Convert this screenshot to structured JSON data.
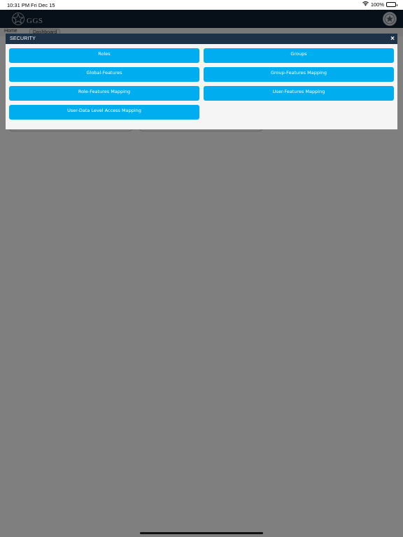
{
  "status_bar": {
    "time": "10:31 PM",
    "date": "Fri Dec 15",
    "battery": "100%",
    "icons": [
      "wifi-icon",
      "battery-icon"
    ]
  },
  "header": {
    "logo_text": "GGS",
    "icons": [
      "emblem-icon",
      "profile-avatar-icon"
    ]
  },
  "subbar": {
    "home_label": "Home",
    "dashboard_tab": "Dashboard"
  },
  "modal": {
    "title": "SECURITY",
    "close_label": "×",
    "buttons": [
      {
        "label": "Roles"
      },
      {
        "label": "Groups"
      },
      {
        "label": "Global-Features"
      },
      {
        "label": "Group-Features Mapping"
      },
      {
        "label": "Role-Features Mapping"
      },
      {
        "label": "User-Features Mapping"
      },
      {
        "label": "User-Data Level Access Mapping"
      }
    ]
  },
  "colors": {
    "header_bg": "#0f1f30",
    "modal_header_bg": "#1d3247",
    "button_bg": "#00adef",
    "overlay": "rgba(0,0,0,0.5)"
  }
}
